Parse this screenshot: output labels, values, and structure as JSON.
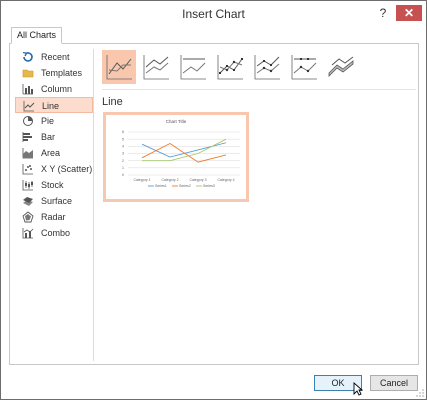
{
  "window": {
    "title": "Insert Chart",
    "help_label": "?",
    "close_label": "✕"
  },
  "tabs": [
    {
      "label": "All Charts"
    }
  ],
  "sidebar": {
    "items": [
      {
        "label": "Recent",
        "icon": "recent-icon"
      },
      {
        "label": "Templates",
        "icon": "folder-icon"
      },
      {
        "label": "Column",
        "icon": "column-chart-icon"
      },
      {
        "label": "Line",
        "icon": "line-chart-icon",
        "selected": true
      },
      {
        "label": "Pie",
        "icon": "pie-chart-icon"
      },
      {
        "label": "Bar",
        "icon": "bar-chart-icon"
      },
      {
        "label": "Area",
        "icon": "area-chart-icon"
      },
      {
        "label": "X Y (Scatter)",
        "icon": "scatter-chart-icon"
      },
      {
        "label": "Stock",
        "icon": "stock-chart-icon"
      },
      {
        "label": "Surface",
        "icon": "surface-chart-icon"
      },
      {
        "label": "Radar",
        "icon": "radar-chart-icon"
      },
      {
        "label": "Combo",
        "icon": "combo-chart-icon"
      }
    ]
  },
  "subtypes": [
    {
      "icon": "line-icon",
      "selected": true
    },
    {
      "icon": "stacked-line-icon"
    },
    {
      "icon": "100-stacked-line-icon"
    },
    {
      "icon": "line-with-markers-icon"
    },
    {
      "icon": "stacked-line-with-markers-icon"
    },
    {
      "icon": "100-stacked-line-with-markers-icon"
    },
    {
      "icon": "3d-line-icon"
    }
  ],
  "main": {
    "heading": "Line"
  },
  "preview": {
    "chart_data": {
      "type": "line",
      "title": "Chart Title",
      "categories": [
        "Category 1",
        "Category 2",
        "Category 3",
        "Category 4"
      ],
      "ylim": [
        0,
        6
      ],
      "yticks": [
        "0",
        "1",
        "2",
        "3",
        "4",
        "5",
        "6"
      ],
      "grid": true,
      "legend_position": "bottom",
      "series": [
        {
          "name": "Series1",
          "values": [
            4.3,
            2.5,
            3.5,
            4.5
          ],
          "color": "#5b9bd5"
        },
        {
          "name": "Series2",
          "values": [
            2.4,
            4.4,
            1.8,
            2.8
          ],
          "color": "#ed7d31"
        },
        {
          "name": "Series3",
          "values": [
            2.0,
            2.0,
            3.0,
            5.0
          ],
          "color": "#a5c96b"
        }
      ]
    }
  },
  "buttons": {
    "ok": "OK",
    "cancel": "Cancel"
  },
  "colors": {
    "accent": "#f9c7ad",
    "selected_bg": "#fbdccd",
    "close_bg": "#c75050"
  }
}
